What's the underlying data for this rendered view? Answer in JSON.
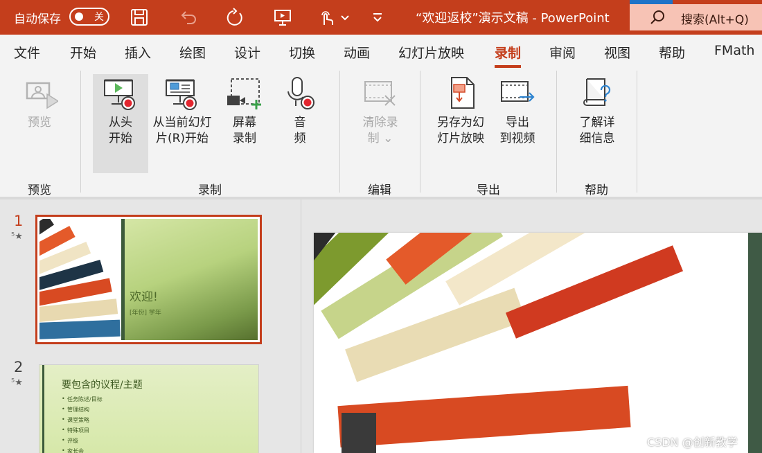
{
  "titlebar": {
    "autosave_label": "自动保存",
    "autosave_state": "关",
    "doc_title": "“欢迎返校”演示文稿  -  PowerPoint",
    "search_label": "搜索(Alt+Q)",
    "color": "#c43e1c",
    "icons": [
      "save-icon",
      "undo-icon",
      "redo-icon",
      "present-icon",
      "touch-mode-icon",
      "chevron-down-icon",
      "customize-icon",
      "search-icon"
    ]
  },
  "tabs": [
    {
      "label": "文件"
    },
    {
      "label": "开始"
    },
    {
      "label": "插入"
    },
    {
      "label": "绘图"
    },
    {
      "label": "设计"
    },
    {
      "label": "切换"
    },
    {
      "label": "动画"
    },
    {
      "label": "幻灯片放映"
    },
    {
      "label": "录制",
      "active": true
    },
    {
      "label": "审阅"
    },
    {
      "label": "视图"
    },
    {
      "label": "帮助"
    },
    {
      "label": "FMath"
    }
  ],
  "ribbon": {
    "groups": {
      "preview": "预览",
      "record": "录制",
      "edit": "编辑",
      "export": "导出",
      "help": "帮助"
    },
    "buttons": {
      "preview": {
        "l1": "预览",
        "l2": ""
      },
      "from_start": {
        "l1": "从头",
        "l2": "开始"
      },
      "from_current": {
        "l1": "从当前幻灯",
        "l2": "片(R)开始"
      },
      "screen_record": {
        "l1": "屏幕",
        "l2": "录制"
      },
      "audio": {
        "l1": "音",
        "l2": "频"
      },
      "clear": {
        "l1": "清除录",
        "l2": "制 ⌄"
      },
      "save_show": {
        "l1": "另存为幻",
        "l2": "灯片放映"
      },
      "export_video": {
        "l1": "导出",
        "l2": "到视频"
      },
      "learn_more": {
        "l1": "了解详",
        "l2": "细信息"
      }
    }
  },
  "slides": [
    {
      "number": "1",
      "title": "欢迎!",
      "subtitle": "[年份] 学年",
      "active": true
    },
    {
      "number": "2",
      "title": "要包含的议程/主题",
      "bullets": [
        "任务陈述/目标",
        "管理结构",
        "课堂策略",
        "特殊项目",
        "评级",
        "家长会"
      ]
    }
  ],
  "watermark": "CSDN @创新教学"
}
